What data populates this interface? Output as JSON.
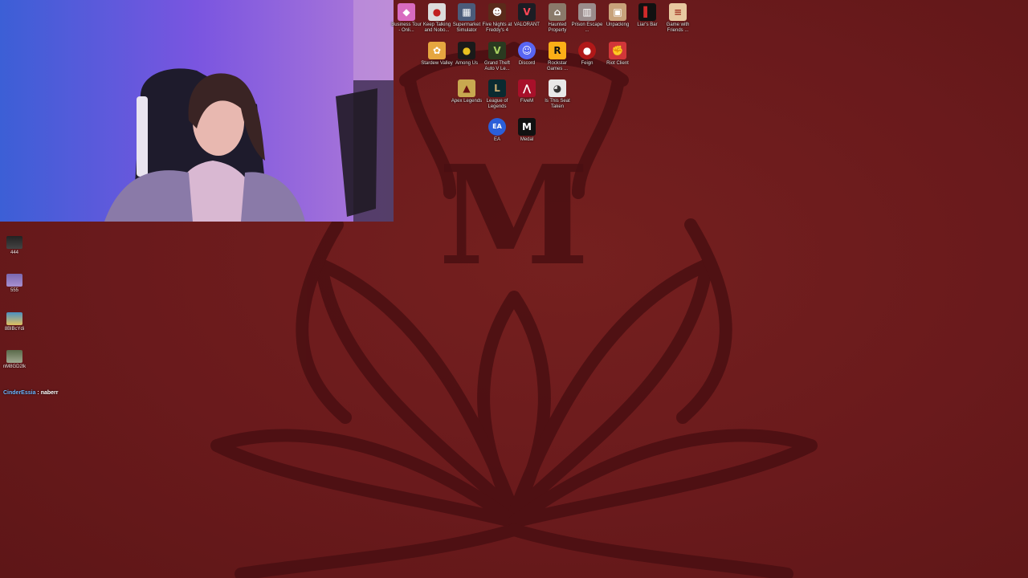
{
  "colors": {
    "wallpaper": "#6a1a1c",
    "wallpaper_emblem": "#4a0f12",
    "chat_username": "#6bb6ff"
  },
  "desktop_icons": [
    {
      "label": "Business Tour - Onli...",
      "icon": "business-tour-icon"
    },
    {
      "label": "Keep Talking and Nobo...",
      "icon": "bomb-icon"
    },
    {
      "label": "Supermarket Simulator",
      "icon": "supermarket-icon"
    },
    {
      "label": "Five Nights at Freddy's 4",
      "icon": "fnaf-icon"
    },
    {
      "label": "VALORANT",
      "icon": "valorant-icon"
    },
    {
      "label": "Haunted Property",
      "icon": "haunted-icon"
    },
    {
      "label": "Prison Escape ...",
      "icon": "prison-icon"
    },
    {
      "label": "Unpacking",
      "icon": "box-icon"
    },
    {
      "label": "Liar's Bar",
      "icon": "liars-bar-icon"
    },
    {
      "label": "Game with Friends ...",
      "icon": "friends-game-icon"
    },
    {
      "label": "Stardew Valley",
      "icon": "stardew-icon"
    },
    {
      "label": "Among Us",
      "icon": "among-us-icon"
    },
    {
      "label": "Grand Theft Auto V Le...",
      "icon": "gta-icon"
    },
    {
      "label": "Discord",
      "icon": "discord-icon"
    },
    {
      "label": "Rockstar Games ...",
      "icon": "rockstar-icon"
    },
    {
      "label": "Feign",
      "icon": "feign-icon"
    },
    {
      "label": "Riot Client",
      "icon": "riot-icon"
    },
    {
      "label": "Apex Legends",
      "icon": "apex-icon"
    },
    {
      "label": "League of Legends",
      "icon": "league-icon"
    },
    {
      "label": "FiveM",
      "icon": "fivem-icon"
    },
    {
      "label": "Is This Seat Taken",
      "icon": "seat-icon"
    },
    {
      "label": "EA",
      "icon": "ea-icon"
    },
    {
      "label": "Medal",
      "icon": "medal-icon"
    }
  ],
  "side_icons": [
    {
      "label": "444"
    },
    {
      "label": "555"
    },
    {
      "label": "8BlBcYdi"
    },
    {
      "label": "nM8GD2lk"
    }
  ],
  "chat": {
    "username": "CinderEssia",
    "separator": " : ",
    "message": "naberr"
  }
}
